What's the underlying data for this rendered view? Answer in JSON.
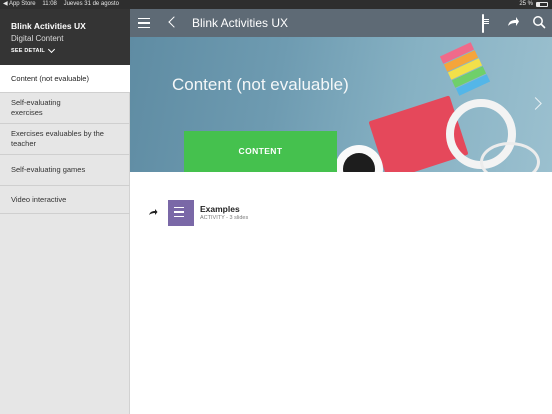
{
  "status_bar": {
    "back_app": "◀ App Store",
    "time": "11:08",
    "date": "Jueves 31 de agosto",
    "battery_percent": "25 %"
  },
  "sidebar": {
    "course_title": "Blink Activities UX",
    "course_subtitle": "Digital Content",
    "see_detail": "SEE DETAIL",
    "items": [
      {
        "label": "Content (not evaluable)",
        "active": true
      },
      {
        "label": "Self-evaluating exercises",
        "active": false
      },
      {
        "label": "Exercises evaluables by the teacher",
        "active": false
      },
      {
        "label": "Self-evaluating games",
        "active": false
      },
      {
        "label": "Video interactive",
        "active": false
      }
    ]
  },
  "topbar": {
    "title": "Blink Activities UX",
    "icons": [
      "document-icon",
      "share-icon",
      "search-icon"
    ]
  },
  "banner": {
    "title": "Content (not evaluable)",
    "button_label": "CONTENT"
  },
  "activities": [
    {
      "title": "Examples",
      "meta": "ACTIVITY - 3 slides",
      "thumb_color": "#7a68a7"
    }
  ],
  "colors": {
    "topbar": "#5e6a75",
    "sidebar_header": "#343434",
    "content_button": "#45c14e",
    "activity_thumb": "#7a68a7"
  }
}
